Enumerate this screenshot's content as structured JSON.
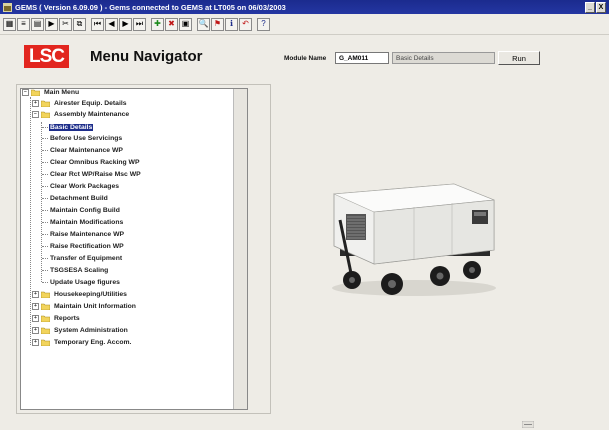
{
  "window": {
    "title": "GEMS ( Version 6.09.09 )  -  Gems connected to GEMS at LT005 on 06/03/2003",
    "buttons": [
      "_",
      "X"
    ]
  },
  "toolbar": {
    "icons": [
      "grid-icon",
      "list-icon",
      "report-icon",
      "run-icon",
      "cut-icon",
      "copy-icon",
      "first-record-icon",
      "prev-record-icon",
      "next-record-icon",
      "last-record-icon",
      "add-record-icon",
      "delete-record-icon",
      "save-icon",
      "search-icon",
      "flag-icon",
      "info-icon",
      "undo-icon",
      "help-icon"
    ],
    "glyphs": [
      "▦",
      "≡",
      "▤",
      "▶",
      "✂",
      "⧉",
      "⏮",
      "◀",
      "▶",
      "⏭",
      "✚",
      "✖",
      "▣",
      "🔍",
      "⚑",
      "ℹ",
      "↶",
      "?"
    ]
  },
  "header": {
    "logo_text": "LSC",
    "title": "Menu Navigator",
    "module_label": "Module Name",
    "module_value": "G_AM011",
    "module_description": "Basic Details",
    "run_label": "Run"
  },
  "tree": {
    "root": "Main Menu",
    "items": [
      {
        "label": "Airester Equip. Details",
        "folder": true
      },
      {
        "label": "Assembly Maintenance",
        "folder": true,
        "expanded": true
      },
      {
        "label": "Basic Details",
        "selected": true
      },
      {
        "label": "Before Use Servicings"
      },
      {
        "label": "Clear Maintenance WP"
      },
      {
        "label": "Clear Omnibus Racking WP"
      },
      {
        "label": "Clear Rct WP/Raise Msc WP"
      },
      {
        "label": "Clear Work Packages"
      },
      {
        "label": "Detachment Build"
      },
      {
        "label": "Maintain Config Build"
      },
      {
        "label": "Maintain Modifications"
      },
      {
        "label": "Raise Maintenance WP"
      },
      {
        "label": "Raise Rectification WP"
      },
      {
        "label": "Transfer of Equipment"
      },
      {
        "label": "TSGSESA Scaling"
      },
      {
        "label": "Update Usage figures"
      },
      {
        "label": "Housekeeping/Utilities",
        "folder": true
      },
      {
        "label": "Maintain Unit Information",
        "folder": true
      },
      {
        "label": "Reports",
        "folder": true
      },
      {
        "label": "System Administration",
        "folder": true
      },
      {
        "label": "Temporary Eng. Accom.",
        "folder": true
      }
    ]
  },
  "colors": {
    "titlebar": "#1b2b8e",
    "logo": "#e2261f",
    "selection": "#1d2d8a"
  }
}
